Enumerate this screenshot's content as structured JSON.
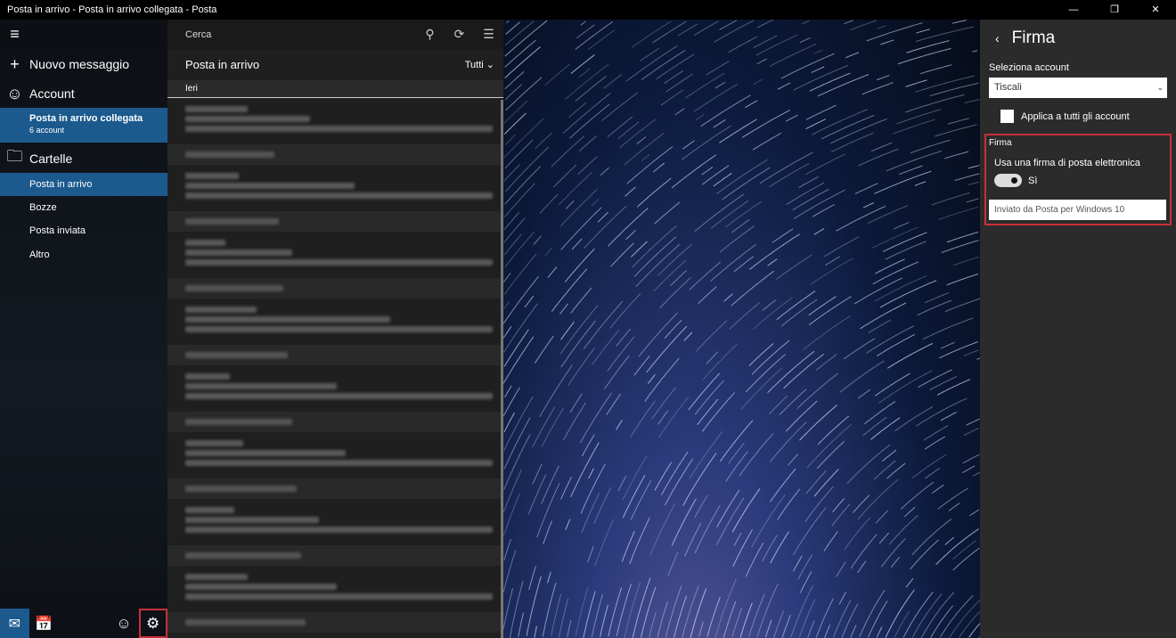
{
  "window": {
    "title": "Posta in arrivo - Posta in arrivo collegata - Posta",
    "minimize": "—",
    "restore": "❐",
    "close": "✕"
  },
  "nav": {
    "new_message": "Nuovo messaggio",
    "account": "Account",
    "linked_inbox": "Posta in arrivo collegata",
    "linked_count": "6 account",
    "folders": "Cartelle",
    "folder_items": [
      "Posta in arrivo",
      "Bozze",
      "Posta inviata",
      "Altro"
    ]
  },
  "list": {
    "search_placeholder": "Cerca",
    "title": "Posta in arrivo",
    "filter": "Tutti",
    "group": "Ieri"
  },
  "settings": {
    "title": "Firma",
    "select_account_label": "Seleziona account",
    "account": "Tiscali",
    "apply_all": "Applica a tutti gli account",
    "section": "Firma",
    "use_signature": "Usa una firma di posta elettronica",
    "toggle_state": "Sì",
    "toggle_on": true,
    "signature_text": "Inviato da Posta per Windows 10"
  },
  "colors": {
    "accent": "#1c5a8e",
    "highlight": "#c8303a"
  }
}
